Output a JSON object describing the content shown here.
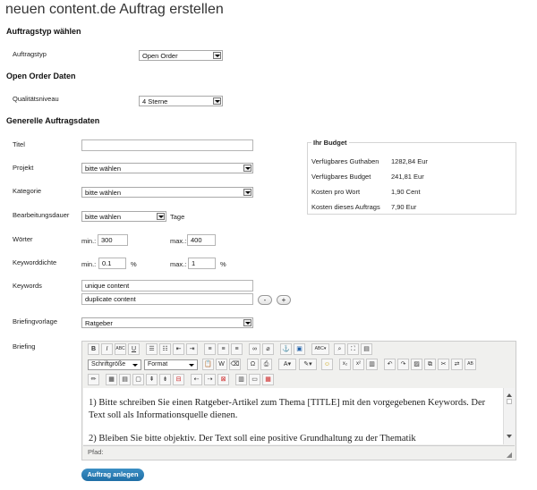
{
  "page": {
    "title": "neuen content.de Auftrag erstellen"
  },
  "sections": {
    "order_type": "Auftragstyp wählen",
    "open_order": "Open Order Daten",
    "general": "Generelle Auftragsdaten"
  },
  "fields": {
    "auftragstyp": {
      "label": "Auftragstyp",
      "value": "Open Order"
    },
    "qualitaet": {
      "label": "Qualitätsniveau",
      "value": "4 Sterne"
    },
    "titel": {
      "label": "Titel",
      "value": ""
    },
    "projekt": {
      "label": "Projekt",
      "value": "bitte wählen"
    },
    "kategorie": {
      "label": "Kategorie",
      "value": "bitte wählen"
    },
    "dauer": {
      "label": "Bearbeitungsdauer",
      "value": "bitte wählen",
      "unit": "Tage"
    },
    "woerter": {
      "label": "Wörter",
      "min_label": "min.:",
      "min": "300",
      "max_label": "max.:",
      "max": "400"
    },
    "dichte": {
      "label": "Keyworddichte",
      "min_label": "min.:",
      "min": "0.1",
      "max_label": "max.:",
      "max": "1",
      "unit": "%"
    },
    "keywords": {
      "label": "Keywords",
      "items": [
        "unique content",
        "duplicate content"
      ],
      "remove": "-",
      "add": "+"
    },
    "vorlage": {
      "label": "Briefingvorlage",
      "value": "Ratgeber"
    },
    "briefing": {
      "label": "Briefing"
    }
  },
  "budget": {
    "title": "Ihr Budget",
    "rows": [
      {
        "label": "Verfügbares Guthaben",
        "value": "1282,84 Eur"
      },
      {
        "label": "Verfügbares Budget",
        "value": "241,81 Eur"
      },
      {
        "label": "Kosten pro Wort",
        "value": "1,90 Cent"
      },
      {
        "label": "Kosten dieses Auftrags",
        "value": "7,90 Eur"
      }
    ]
  },
  "editor": {
    "font_size": "Schriftgröße",
    "format": "Format",
    "text1": "1) Bitte schreiben Sie einen Ratgeber-Artikel zum Thema [TITLE] mit den vorgegebenen Keywords. Der Text soll als Informationsquelle dienen.",
    "text2": "2) Bleiben Sie bitte objektiv. Der Text soll eine positive Grundhaltung zu der Thematik",
    "status_path": "Pfad:"
  },
  "submit_label": "Auftrag anlegen"
}
